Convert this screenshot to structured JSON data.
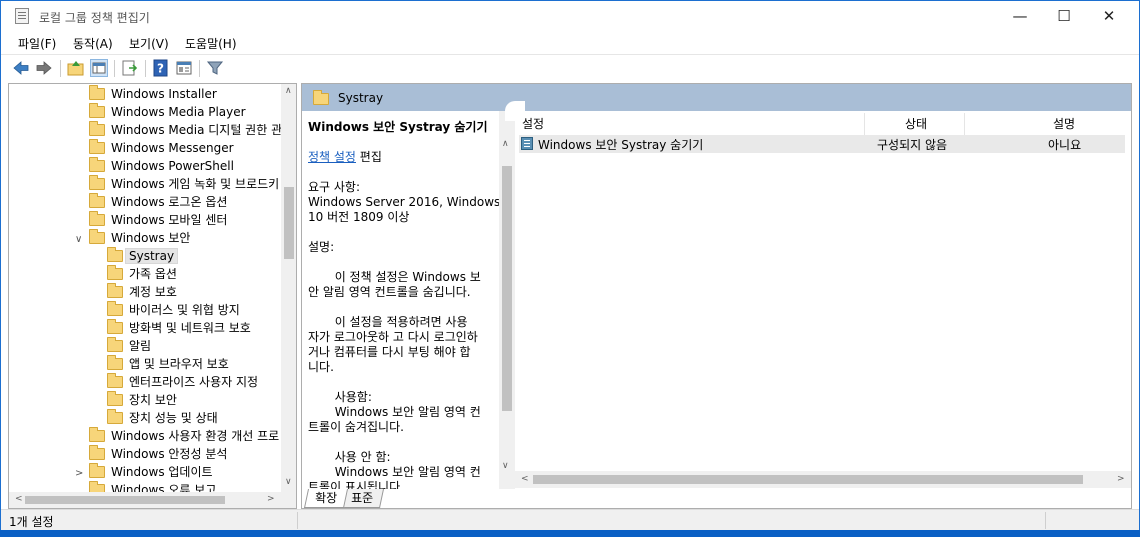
{
  "window": {
    "title": "로컬 그룹 정책 편집기",
    "minimize": "—",
    "maximize": "☐",
    "close": "✕"
  },
  "menu": [
    {
      "label": "파일(F)"
    },
    {
      "label": "동작(A)"
    },
    {
      "label": "보기(V)"
    },
    {
      "label": "도움말(H)"
    }
  ],
  "toolbar": {
    "icons": [
      "back-arrow-icon",
      "forward-arrow-icon",
      "up-folder-icon",
      "show-hide-tree-icon",
      "export-list-icon",
      "help-icon",
      "view-icon",
      "filter-icon"
    ],
    "help_glyph": "?"
  },
  "tree": {
    "items": [
      {
        "label": "Windows Installer",
        "level": 1
      },
      {
        "label": "Windows Media Player",
        "level": 1
      },
      {
        "label": "Windows Media 디지털 권한 관",
        "level": 1
      },
      {
        "label": "Windows Messenger",
        "level": 1
      },
      {
        "label": "Windows PowerShell",
        "level": 1
      },
      {
        "label": "Windows 게임 녹화 및 브로드키",
        "level": 1
      },
      {
        "label": "Windows 로그온 옵션",
        "level": 1
      },
      {
        "label": "Windows 모바일 센터",
        "level": 1
      },
      {
        "label": "Windows 보안",
        "level": 1,
        "expanded": true
      },
      {
        "label": "Systray",
        "level": 2,
        "selected": true
      },
      {
        "label": "가족 옵션",
        "level": 2
      },
      {
        "label": "계정 보호",
        "level": 2
      },
      {
        "label": "바이러스 및 위협 방지",
        "level": 2
      },
      {
        "label": "방화벽 및 네트워크 보호",
        "level": 2
      },
      {
        "label": "알림",
        "level": 2
      },
      {
        "label": "앱 및 브라우저 보호",
        "level": 2
      },
      {
        "label": "엔터프라이즈 사용자 지정",
        "level": 2
      },
      {
        "label": "장치 보안",
        "level": 2
      },
      {
        "label": "장치 성능 및 상태",
        "level": 2
      },
      {
        "label": "Windows 사용자 환경 개선 프로",
        "level": 1
      },
      {
        "label": "Windows 안정성 분석",
        "level": 1
      },
      {
        "label": "Windows 업데이트",
        "level": 1,
        "collapsed": true
      },
      {
        "label": "Windows 오류 보고",
        "level": 1
      }
    ],
    "expand_glyph": "∨",
    "collapse_glyph": ">"
  },
  "right": {
    "header_title": "Systray",
    "description": {
      "title": "Windows 보안 Systray 숨기기",
      "edit_link": "정책 설정",
      "edit_suffix": " 편집",
      "requirements_label": "요구 사항:",
      "requirements": "Windows Server 2016, Windows\n10 버전 1809 이상",
      "desc_label": "설명:",
      "p1": "       이 정책 설정은 Windows 보\n안 알림 영역 컨트롤을 숨깁니다.",
      "p2": "       이 설정을 적용하려면 사용\n자가 로그아웃하 고 다시 로그인하\n거나 컴퓨터를 다시 부팅 해야 합\n니다.",
      "p3_label": "       사용함:",
      "p3": "       Windows 보안 알림 영역 컨\n트롤이 숨겨집니다.",
      "p4_label": "       사용 안 함:",
      "p4": "       Windows 보안 알림 영역 컨\n트롤이 표시됩니다."
    },
    "columns": [
      "설정",
      "상태",
      "설명"
    ],
    "rows": [
      {
        "setting": "Windows 보안 Systray 숨기기",
        "state": "구성되지 않음",
        "comment": "아니요"
      }
    ],
    "tabs": [
      {
        "label": "확장"
      },
      {
        "label": "표준"
      }
    ]
  },
  "status": {
    "text": "1개 설정"
  },
  "colors": {
    "header_bg": "#a9bed6",
    "link": "#1a5fbf",
    "folder": "#f7d57a",
    "selection": "#e5e5e5"
  }
}
